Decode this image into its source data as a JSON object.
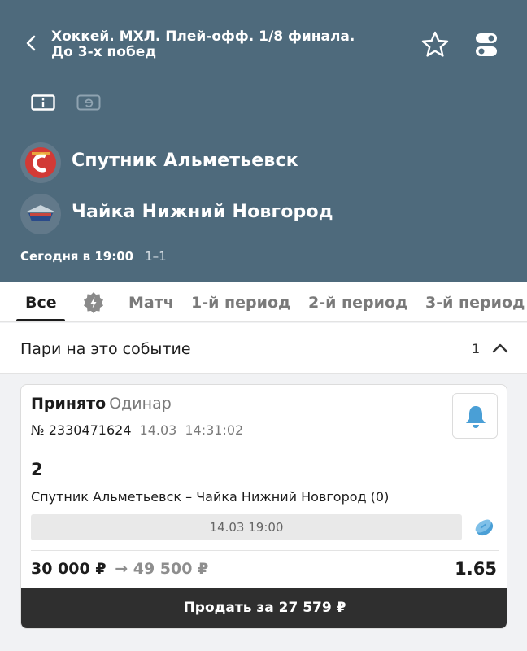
{
  "header": {
    "title": "Хоккей. МХЛ. Плей-офф. 1/8 финала. До 3-х побед",
    "team1": "Спутник Альметьевск",
    "team2": "Чайка Нижний Новгород",
    "date": "Сегодня в 19:00",
    "score": "1–1"
  },
  "tabs": [
    {
      "label": "Все"
    },
    {
      "label": "Матч"
    },
    {
      "label": "1-й период"
    },
    {
      "label": "2-й период"
    },
    {
      "label": "3-й период"
    }
  ],
  "section": {
    "label": "Пари на это событие",
    "count": "1"
  },
  "bet": {
    "status": "Принято",
    "type": "Одинар",
    "number": "№ 2330471624",
    "date": "14.03",
    "time": "14:31:02",
    "outcome": "2",
    "event": "Спутник Альметьевск – Чайка Нижний Новгород (0)",
    "event_date": "14.03 19:00",
    "stake": "30 000 ₽",
    "arrow": "→",
    "win": "49 500 ₽",
    "coef": "1.65",
    "sell_label": "Продать за 27 579 ₽"
  },
  "colors": {
    "header_bg": "#4e6a7c",
    "accent_blue": "#4a9fd6",
    "sell_bg": "#2f2f2f"
  },
  "icons": [
    "back-arrow-icon",
    "star-icon",
    "toggle-icon",
    "info-view-icon",
    "e-view-icon",
    "team-logo-icon",
    "live-badge-icon",
    "chevron-up-icon",
    "bell-icon",
    "puck-icon"
  ]
}
